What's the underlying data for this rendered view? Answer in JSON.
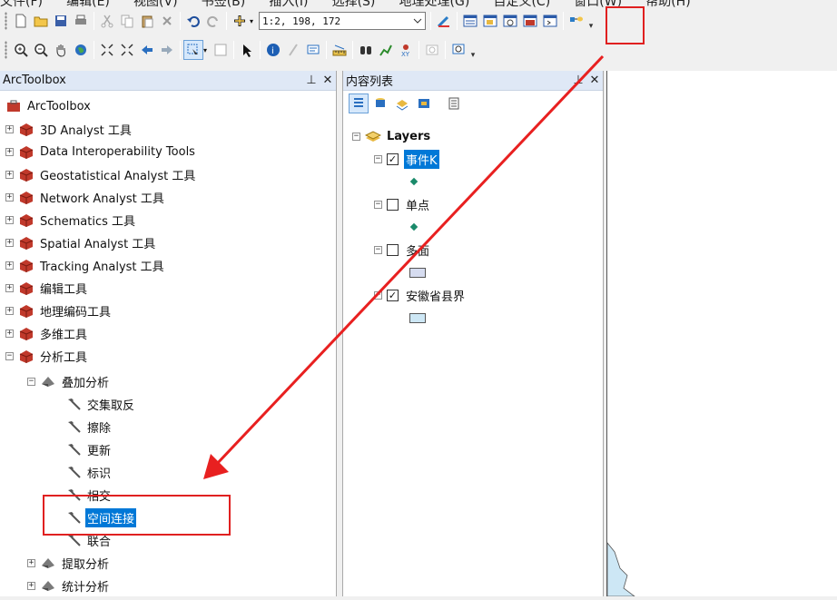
{
  "menubar": {
    "items": [
      "文件(F)",
      "编辑(E)",
      "视图(V)",
      "书签(B)",
      "插入(I)",
      "选择(S)",
      "地理处理(G)",
      "自定义(C)",
      "窗口(W)",
      "帮助(H)"
    ]
  },
  "toolbar": {
    "scale_value": "1:2, 198, 172"
  },
  "toolbox": {
    "title": "ArcToolbox",
    "root_label": "ArcToolbox",
    "items": [
      "3D Analyst 工具",
      "Data Interoperability Tools",
      "Geostatistical Analyst 工具",
      "Network Analyst 工具",
      "Schematics 工具",
      "Spatial Analyst 工具",
      "Tracking Analyst 工具",
      "编辑工具",
      "地理编码工具",
      "多维工具",
      "分析工具"
    ],
    "overlay_group": "叠加分析",
    "overlay_tools": [
      "交集取反",
      "擦除",
      "更新",
      "标识",
      "相交",
      "空间连接",
      "联合"
    ],
    "other_groups": [
      "提取分析",
      "统计分析"
    ]
  },
  "toc": {
    "title": "内容列表",
    "group_label": "Layers",
    "layers": [
      {
        "name": "事件K",
        "checked": true
      },
      {
        "name": "单点",
        "checked": false
      },
      {
        "name": "多面",
        "checked": false
      },
      {
        "name": "安徽省县界",
        "checked": true
      }
    ]
  },
  "colors": {
    "highlight_red": "#e02020",
    "selection_blue": "#0078d7",
    "pane_header": "#dfe8f6",
    "polygon_fill_1": "#d6dcf0",
    "polygon_fill_2": "#cde7f5"
  }
}
